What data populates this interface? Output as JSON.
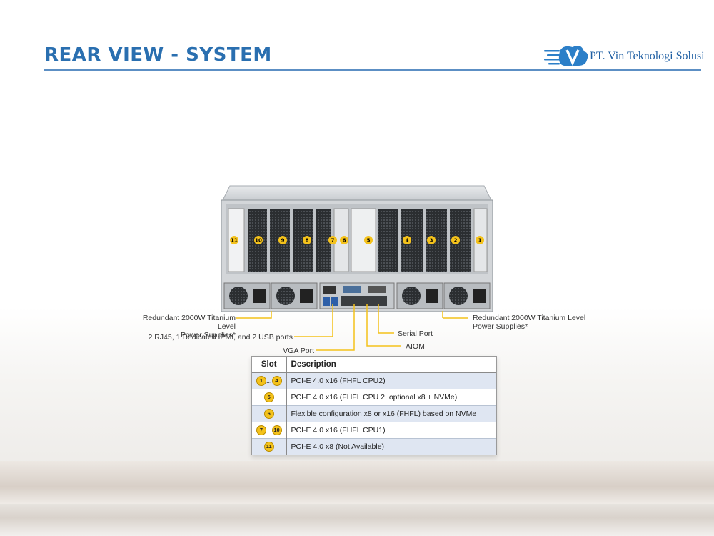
{
  "header": {
    "title": "REAR VIEW - SYSTEM",
    "company": "PT. Vin Teknologi Solusi"
  },
  "server": {
    "slot_labels": [
      "11",
      "10",
      "9",
      "8",
      "7",
      "6",
      "5",
      "4",
      "3",
      "2",
      "1"
    ]
  },
  "callouts": {
    "psu_left": "Redundant 2000W Titanium Level\nPower Supplies*",
    "psu_right": "Redundant 2000W Titanium Level\nPower Supplies*",
    "ports": "2 RJ45, 1 Dedicated IPMI, and 2 USB ports",
    "vga": "VGA Port",
    "serial": "Serial Port",
    "aiom": "AIOM"
  },
  "table": {
    "headers": [
      "Slot",
      "Description"
    ],
    "rows": [
      {
        "slot_start": "1",
        "slot_sep": "...",
        "slot_end": "4",
        "desc": "PCI-E 4.0 x16 (FHFL CPU2)"
      },
      {
        "slot_start": "5",
        "slot_sep": "",
        "slot_end": "",
        "desc": "PCI-E 4.0 x16 (FHFL CPU 2, optional x8 + NVMe)"
      },
      {
        "slot_start": "6",
        "slot_sep": "",
        "slot_end": "",
        "desc": "Flexible configuration x8 or x16 (FHFL) based on NVMe"
      },
      {
        "slot_start": "7",
        "slot_sep": "...",
        "slot_end": "10",
        "desc": "PCI-E 4.0 x16 (FHFL CPU1)"
      },
      {
        "slot_start": "11",
        "slot_sep": "",
        "slot_end": "",
        "desc": "PCI-E 4.0 x8 (Not Available)"
      }
    ]
  },
  "colors": {
    "title": "#2a6fb0",
    "callout_line": "#f4c21b",
    "badge": "#f4c21b",
    "table_shade": "#dfe6f2"
  }
}
